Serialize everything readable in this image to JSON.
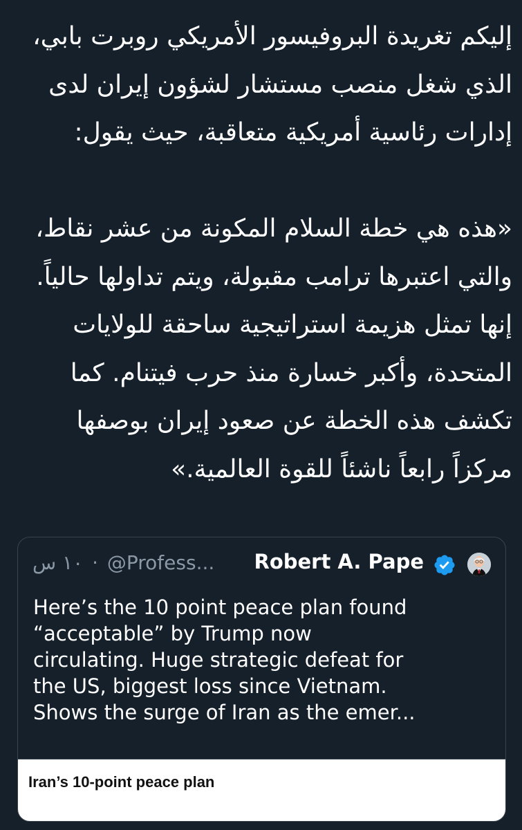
{
  "post": {
    "arabic_lines": [
      "إليكم تغريدة البروفيسور الأمريكي روبرت بابي،",
      "الذي شغل منصب مستشار لشؤون إيران لدى",
      "إدارات رئاسية أمريكية متعاقبة، حيث يقول:",
      "«هذه هي خطة السلام المكونة من عشر نقاط،",
      "والتي اعتبرها ترامب مقبولة، ويتم تداولها حالياً.",
      "إنها تمثل هزيمة استراتيجية ساحقة للولايات",
      "المتحدة، وأكبر خسارة منذ حرب فيتنام. كما",
      "تكشف هذه الخطة عن صعود إيران بوصفها",
      "مركزاً رابعاً ناشئاً للقوة العالمية.»"
    ]
  },
  "quote": {
    "author_name": "Robert A. Pape",
    "handle": "@Profess...",
    "separator": "·",
    "time": "١٠ س",
    "verified_icon": "verified-badge-icon",
    "avatar_icon": "profile-avatar",
    "text_lines": [
      "Here’s the 10 point peace plan found",
      "“acceptable” by Trump now",
      "circulating.  Huge strategic defeat for",
      "the US, biggest loss since Vietnam.",
      "Shows the surge of Iran as the emer..."
    ],
    "media_title": "Iran’s 10-point peace plan"
  },
  "colors": {
    "background": "#15202b",
    "text": "#ffffff",
    "muted": "#8b98a5",
    "border": "#38444d",
    "verified": "#1d9bf0"
  }
}
